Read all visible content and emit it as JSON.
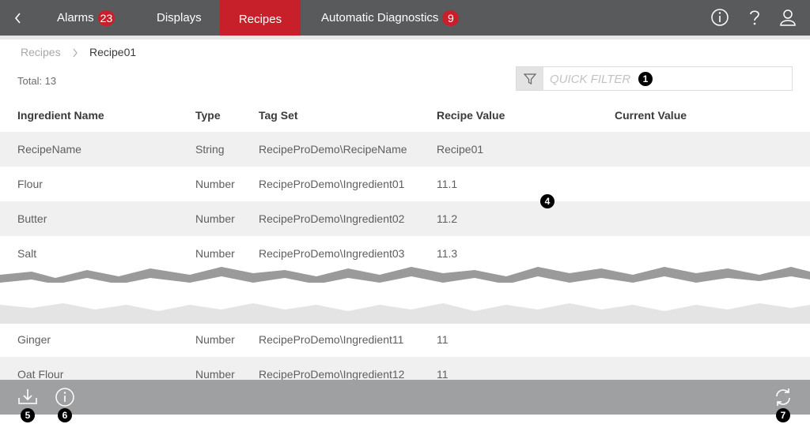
{
  "nav": {
    "tabs": [
      {
        "label": "Alarms",
        "badge": "23"
      },
      {
        "label": "Displays"
      },
      {
        "label": "Recipes"
      },
      {
        "label": "Automatic Diagnostics",
        "badge": "9"
      }
    ],
    "active_tab": "Recipes"
  },
  "breadcrumb": {
    "root": "Recipes",
    "current": "Recipe01"
  },
  "total_label": "Total: 13",
  "filter": {
    "placeholder": "QUICK FILTER"
  },
  "table": {
    "columns": [
      "Ingredient Name",
      "Type",
      "Tag Set",
      "Recipe Value",
      "Current Value"
    ],
    "rows": [
      [
        "RecipeName",
        "String",
        "RecipeProDemo\\RecipeName",
        "Recipe01",
        ""
      ],
      [
        "Flour",
        "Number",
        "RecipeProDemo\\Ingredient01",
        "11.1",
        ""
      ],
      [
        "Butter",
        "Number",
        "RecipeProDemo\\Ingredient02",
        "11.2",
        ""
      ],
      [
        "Salt",
        "Number",
        "RecipeProDemo\\Ingredient03",
        "11.3",
        ""
      ],
      [
        "Ginger",
        "Number",
        "RecipeProDemo\\Ingredient11",
        "11",
        ""
      ],
      [
        "Oat Flour",
        "Number",
        "RecipeProDemo\\Ingredient12",
        "11",
        ""
      ]
    ]
  },
  "callouts": [
    "1",
    "4",
    "5",
    "6",
    "7"
  ],
  "colors": {
    "topbar": "#595a5c",
    "accent": "#c8202a",
    "bottombar": "#9fa0a2",
    "row_shade": "#f0f0f0"
  },
  "icons": [
    "back-chevron-icon",
    "info-icon",
    "help-icon",
    "user-icon",
    "filter-icon",
    "download-icon",
    "info-icon",
    "refresh-icon"
  ]
}
